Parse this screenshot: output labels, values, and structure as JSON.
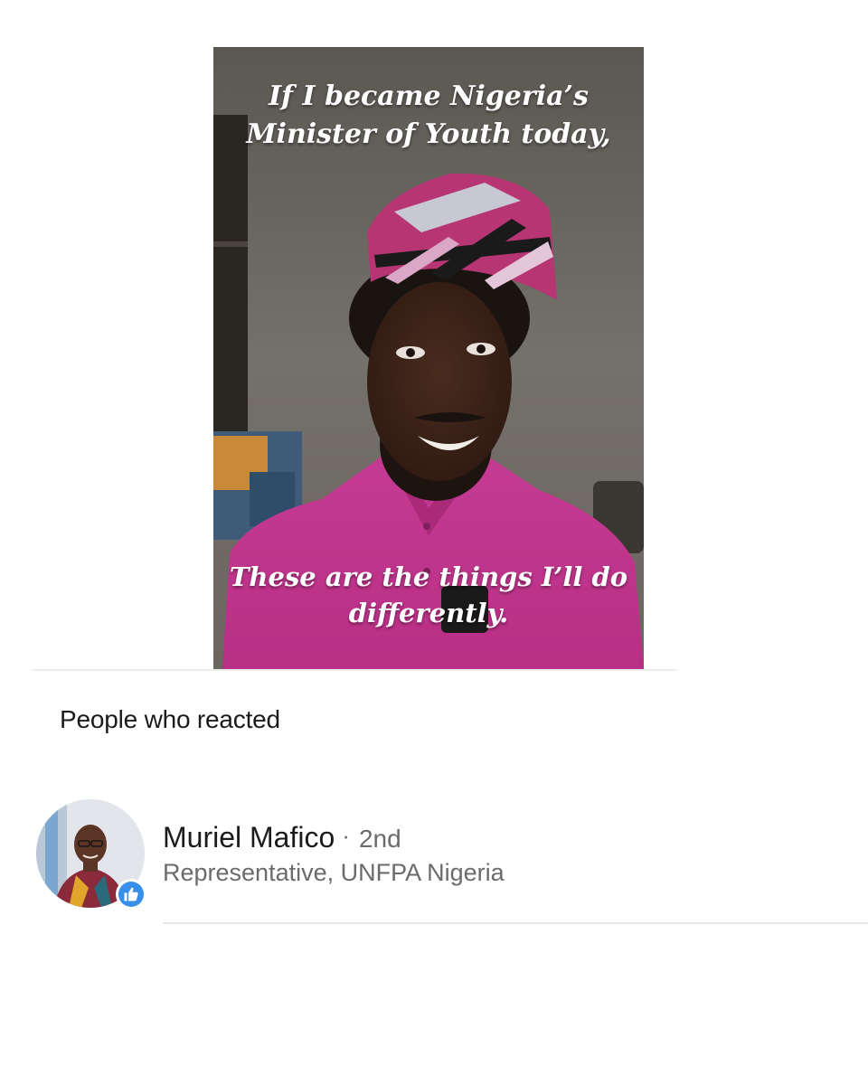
{
  "post": {
    "video": {
      "caption_top": "If I became Nigeria’s\nMinister of Youth today,",
      "caption_bottom": "These are the things I’ll do\ndifferently.",
      "icon": "video-thumbnail"
    }
  },
  "reactions": {
    "title": "People who reacted",
    "people": [
      {
        "name": "Muriel Mafico",
        "separator": "·",
        "degree": "2nd",
        "headline": "Representative, UNFPA Nigeria",
        "reaction_icon": "like-icon",
        "reaction_color": "#378fe9"
      }
    ]
  },
  "colors": {
    "shirt": "#c8358f",
    "cap_pink": "#b63572",
    "like_blue": "#378fe9",
    "text_primary": "#1b1b1b",
    "text_secondary": "#6b6b6b"
  }
}
